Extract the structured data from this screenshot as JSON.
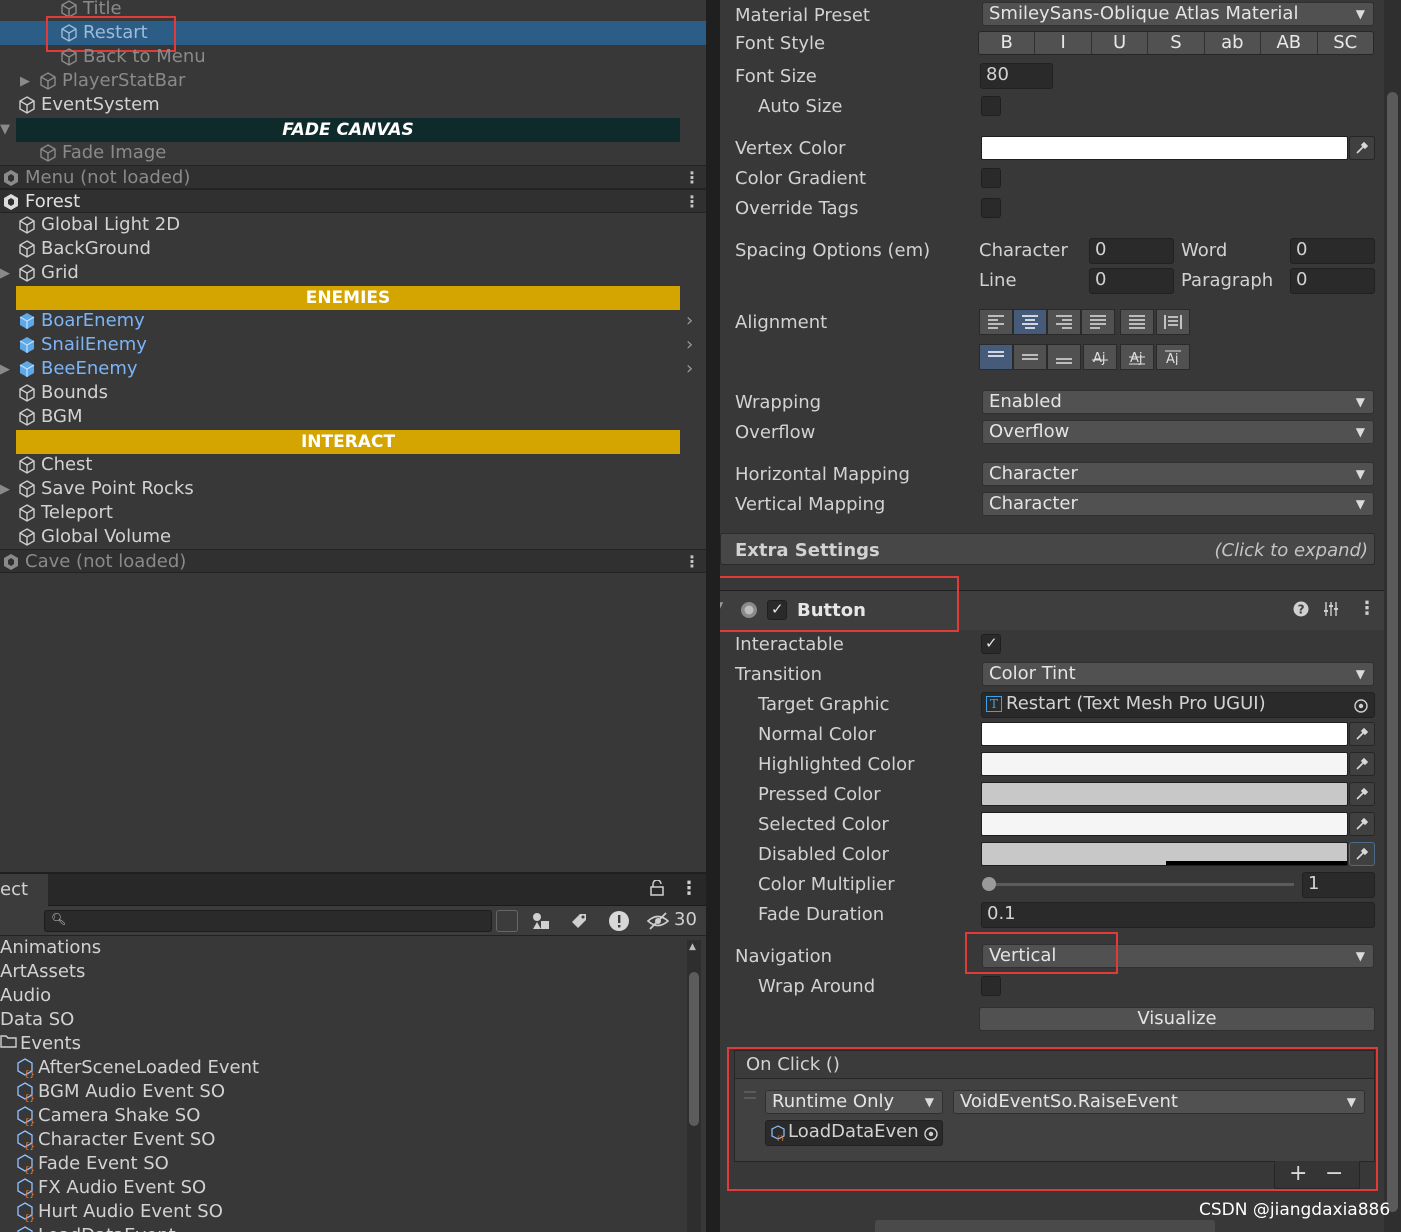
{
  "hierarchy": {
    "rows": [
      {
        "label": "Title"
      },
      {
        "label": "Restart"
      },
      {
        "label": "Back to Menu"
      },
      {
        "label": "PlayerStatBar"
      },
      {
        "label": "EventSystem"
      },
      {
        "label": "Fade Image"
      },
      {
        "label": "Global Light 2D"
      },
      {
        "label": "BackGround"
      },
      {
        "label": "Grid"
      },
      {
        "label": "BoarEnemy"
      },
      {
        "label": "SnailEnemy"
      },
      {
        "label": "BeeEnemy"
      },
      {
        "label": "Bounds"
      },
      {
        "label": "BGM"
      },
      {
        "label": "Chest"
      },
      {
        "label": "Save Point Rocks"
      },
      {
        "label": "Teleport"
      },
      {
        "label": "Global Volume"
      }
    ],
    "scenes": [
      {
        "label": "Menu (not loaded)"
      },
      {
        "label": "Forest"
      },
      {
        "label": "Cave (not loaded)"
      }
    ],
    "banners": [
      {
        "label": "FADE CANVAS",
        "bg": "#0e2a2a",
        "color": "#ffffff"
      },
      {
        "label": "ENEMIES",
        "bg": "#d4a400",
        "color": "#ffffff"
      },
      {
        "label": "INTERACT",
        "bg": "#d4a400",
        "color": "#ffffff"
      }
    ]
  },
  "project": {
    "tab_label": "ect",
    "hidden_count": "30",
    "folders": [
      "Animations",
      "ArtAssets",
      "Audio",
      "Data SO",
      "Events"
    ],
    "event_items": [
      "AfterSceneLoaded Event",
      "BGM Audio Event SO",
      "Camera Shake SO",
      "Character Event SO",
      "Fade Event SO",
      "FX Audio Event SO",
      "Hurt Audio Event SO",
      "LoadDataEvent"
    ]
  },
  "inspector": {
    "text": {
      "material_preset_label": "Material Preset",
      "material_preset_value": "SmileySans-Oblique Atlas Material",
      "font_style_label": "Font Style",
      "font_style_buttons": [
        "B",
        "I",
        "U",
        "S",
        "ab",
        "AB",
        "SC"
      ],
      "font_size_label": "Font Size",
      "font_size_value": "80",
      "auto_size_label": "Auto Size",
      "vertex_color_label": "Vertex Color",
      "color_gradient_label": "Color Gradient",
      "override_tags_label": "Override Tags",
      "spacing_label": "Spacing Options (em)",
      "character_label": "Character",
      "character_value": "0",
      "word_label": "Word",
      "word_value": "0",
      "line_label": "Line",
      "line_value": "0",
      "paragraph_label": "Paragraph",
      "paragraph_value": "0",
      "alignment_label": "Alignment",
      "wrapping_label": "Wrapping",
      "wrapping_value": "Enabled",
      "overflow_label": "Overflow",
      "overflow_value": "Overflow",
      "hmap_label": "Horizontal Mapping",
      "hmap_value": "Character",
      "vmap_label": "Vertical Mapping",
      "vmap_value": "Character",
      "extra_settings_label": "Extra Settings",
      "extra_settings_hint": "(Click to expand)"
    },
    "button": {
      "title": "Button",
      "interactable_label": "Interactable",
      "transition_label": "Transition",
      "transition_value": "Color Tint",
      "target_graphic_label": "Target Graphic",
      "target_graphic_value": "Restart (Text Mesh Pro UGUI)",
      "normal_color_label": "Normal Color",
      "highlighted_color_label": "Highlighted Color",
      "pressed_color_label": "Pressed Color",
      "selected_color_label": "Selected Color",
      "disabled_color_label": "Disabled Color",
      "color_multiplier_label": "Color Multiplier",
      "color_multiplier_value": "1",
      "fade_duration_label": "Fade Duration",
      "fade_duration_value": "0.1",
      "navigation_label": "Navigation",
      "navigation_value": "Vertical",
      "wrap_around_label": "Wrap Around",
      "visualize_label": "Visualize",
      "colors": {
        "normal": "#ffffff",
        "highlighted": "#f5f5f5",
        "pressed": "#c8c8c8",
        "selected": "#f5f5f5",
        "disabled": "#c8c8c8"
      }
    },
    "onclick": {
      "header": "On Click ()",
      "runtime_value": "Runtime Only",
      "function_value": "VoidEventSo.RaiseEvent",
      "object_value": "LoadDataEven",
      "add_label": "+",
      "remove_label": "−"
    }
  },
  "watermark": "CSDN @jiangdaxia886"
}
